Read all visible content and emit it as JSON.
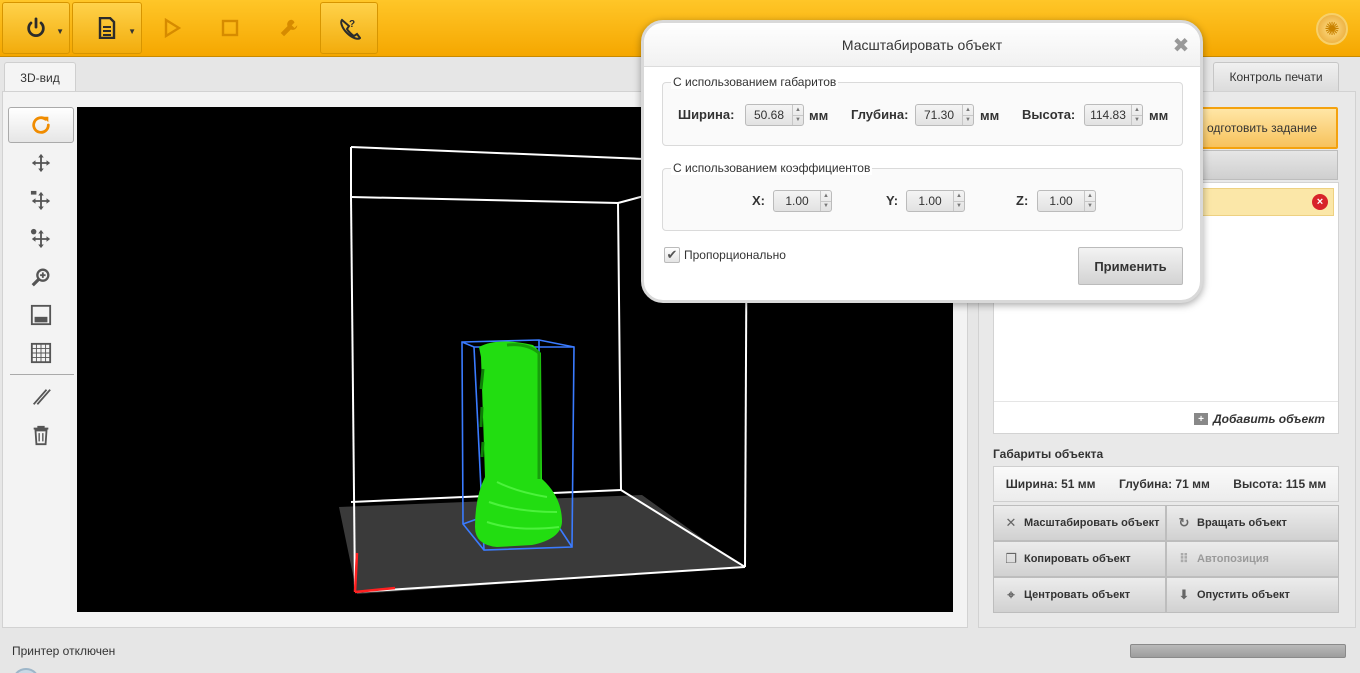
{
  "toolbar": {
    "items": [
      {
        "name": "power",
        "icon": "power-icon"
      },
      {
        "name": "file",
        "icon": "document-icon"
      },
      {
        "name": "play",
        "icon": "play-icon"
      },
      {
        "name": "stop",
        "icon": "stop-icon"
      },
      {
        "name": "tools",
        "icon": "wrench-icon"
      },
      {
        "name": "help",
        "icon": "help-call-icon"
      }
    ],
    "settings_icon": "settings-gear-icon"
  },
  "tabs": {
    "view3d": "3D-вид",
    "print_control": "Контроль печати"
  },
  "side_tools": [
    "rotate-icon",
    "move-icon",
    "move-pan-icon",
    "move-object-icon",
    "zoom-icon",
    "top-view-icon",
    "grid-icon",
    "slice-icon",
    "delete-icon"
  ],
  "right": {
    "prepare_label": "одготовить задание",
    "add_object_label": "Добавить объект",
    "dims_title": "Габариты объекта",
    "dims": {
      "width": "Ширина: 51 мм",
      "depth": "Глубина: 71 мм",
      "height": "Высота: 115 мм"
    },
    "actions": {
      "scale": "Масштабировать объект",
      "rotate": "Вращать объект",
      "copy": "Копировать объект",
      "autopos": "Автопозиция",
      "center": "Центровать объект",
      "drop": "Опустить объект"
    }
  },
  "status": {
    "printer": "Принтер отключен"
  },
  "modal": {
    "title": "Масштабировать объект",
    "group_dims_label": "С использованием габаритов",
    "group_coef_label": "С использованием коэффициентов",
    "width_label": "Ширина:",
    "width_value": "50.68",
    "depth_label": "Глубина:",
    "depth_value": "71.30",
    "height_label": "Высота:",
    "height_value": "114.83",
    "unit": "мм",
    "x_label": "X:",
    "x_value": "1.00",
    "y_label": "Y:",
    "y_value": "1.00",
    "z_label": "Z:",
    "z_value": "1.00",
    "proportional_label": "Пропорционально",
    "proportional_checked": true,
    "apply_label": "Применить"
  },
  "colors": {
    "toolbar": "#f5a700",
    "model": "#22dd11",
    "bbox": "#3a7bff",
    "axis_x": "#ff2020",
    "frame": "#ffffff"
  }
}
